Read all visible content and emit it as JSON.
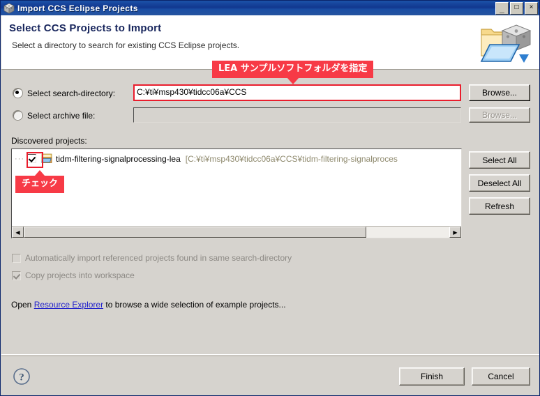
{
  "window": {
    "title": "Import CCS Eclipse Projects",
    "icon": "cube-icon",
    "minimize_label": "_",
    "maximize_label": "□",
    "close_label": "×"
  },
  "banner": {
    "title": "Select CCS Projects to Import",
    "subtitle": "Select a directory to search for existing CCS Eclipse projects.",
    "icon": "import-project-folder-icon"
  },
  "source": {
    "search_directory_radio_label": "Select search-directory:",
    "search_directory_value": "C:¥ti¥msp430¥tidcc06a¥CCS",
    "search_directory_selected": true,
    "archive_radio_label": "Select archive file:",
    "archive_value": "",
    "archive_selected": false,
    "browse_label": "Browse...",
    "browse_archive_label": "Browse..."
  },
  "projects": {
    "list_label": "Discovered projects:",
    "items": [
      {
        "checked": true,
        "name": "tidm-filtering-signalprocessing-lea",
        "path": "[C:¥ti¥msp430¥tidcc06a¥CCS¥tidm-filtering-signalproces"
      }
    ],
    "select_all_label": "Select All",
    "deselect_all_label": "Deselect All",
    "refresh_label": "Refresh"
  },
  "options": {
    "auto_import_label": "Automatically import referenced projects found in same search-directory",
    "auto_import_checked": false,
    "copy_projects_label": "Copy projects into workspace",
    "copy_projects_checked": true
  },
  "resource_hint": {
    "prefix": "Open ",
    "link": "Resource Explorer",
    "suffix": " to browse a wide selection of example projects..."
  },
  "footer": {
    "help_label": "?",
    "finish_label": "Finish",
    "cancel_label": "Cancel"
  },
  "annotations": [
    {
      "text": "LEA サンプルソフトフォルダを指定",
      "direction": "down"
    },
    {
      "text": "チェック",
      "direction": "up"
    }
  ],
  "colors": {
    "accent_red": "#f73a46",
    "titlebar_blue": "#11378f",
    "link_blue": "#2222cc",
    "panel_grey": "#d6d3ce"
  }
}
